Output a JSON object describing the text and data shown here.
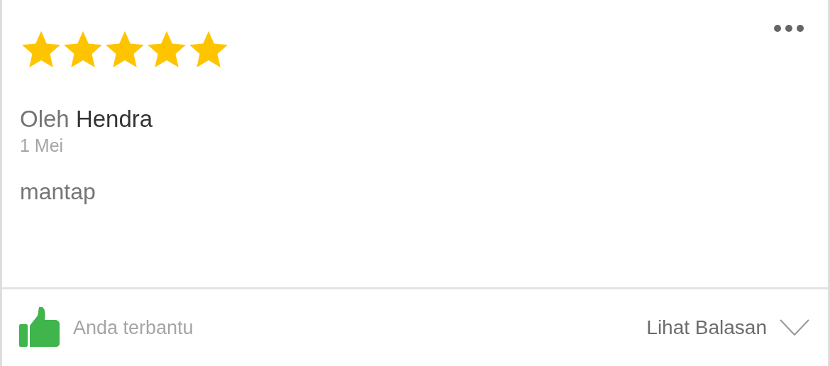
{
  "review": {
    "stars": 5,
    "author_prefix": "Oleh",
    "author": "Hendra",
    "date": "1 Mei",
    "text": "mantap"
  },
  "footer": {
    "helpful": true,
    "helpful_label": "Anda terbantu",
    "replies_label": "Lihat Balasan",
    "expanded": false
  }
}
